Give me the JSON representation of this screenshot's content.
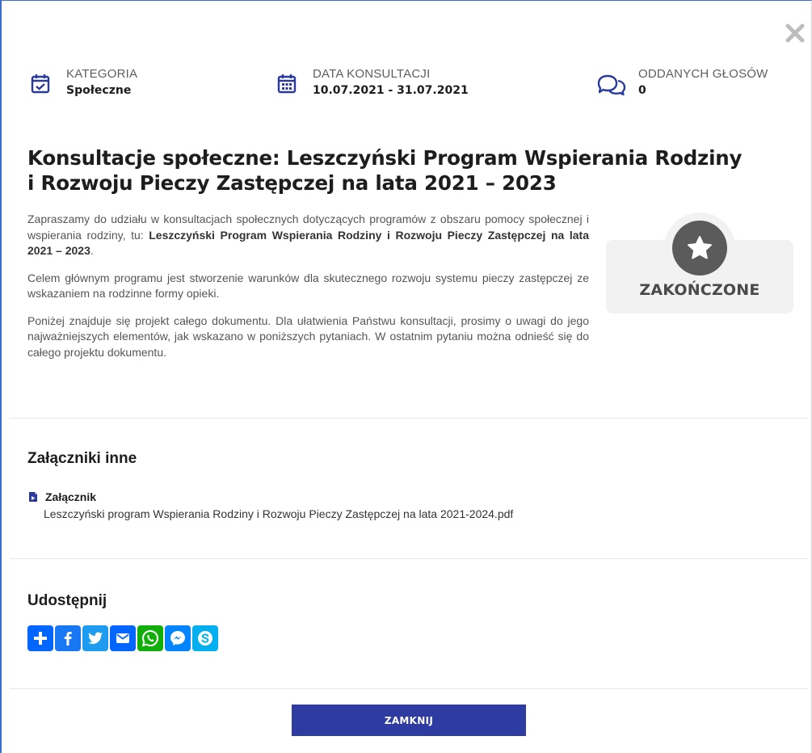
{
  "modal": {
    "close_icon": "close-icon",
    "meta": {
      "category": {
        "label": "KATEGORIA",
        "value": "Społeczne",
        "icon": "calendar-check-icon"
      },
      "date": {
        "label": "DATA KONSULTACJI",
        "value": "10.07.2021 - 31.07.2021",
        "icon": "calendar-icon"
      },
      "votes": {
        "label": "ODDANYCH GŁOSÓW",
        "value": "0",
        "icon": "chat-bubbles-icon"
      }
    },
    "title": "Konsultacje społeczne: Leszczyński Program Wspierania Rodziny i Rozwoju Pieczy Zastępczej na lata 2021 – 2023",
    "description": {
      "p1_pre": "Zapraszamy do udziału w konsultacjach społecznych dotyczących programów z obszaru pomocy społecznej i wspierania rodziny, tu: ",
      "p1_bold": "Leszczyński Program Wspierania Rodziny i Rozwoju Pieczy Zastępczej na lata 2021 – 2023",
      "p1_post": ".",
      "p2": "Celem głównym programu jest stworzenie warunków dla skutecznego rozwoju systemu pieczy zastępczej ze wskazaniem na rodzinne formy opieki.",
      "p3": "Poniżej znajduje się projekt całego dokumentu. Dla ułatwienia Państwu konsultacji, prosimy o uwagi do jego najważniejszych elementów, jak wskazano w poniższych pytaniach. W ostatnim pytaniu można odnieść się do całego projektu dokumentu."
    },
    "status": {
      "label": "ZAKOŃCZONE",
      "icon": "star-icon"
    },
    "attachments": {
      "title": "Załączniki inne",
      "label": "Załącznik",
      "file": "Leszczyński program Wspierania Rodziny i Rozwoju Pieczy Zastępczej na lata 2021-2024.pdf",
      "icon": "file-icon"
    },
    "share": {
      "title": "Udostępnij",
      "buttons": [
        {
          "name": "addtoany",
          "icon": "plus-icon",
          "color": "#0166ff"
        },
        {
          "name": "facebook",
          "icon": "facebook-icon",
          "color": "#1877f2"
        },
        {
          "name": "twitter",
          "icon": "twitter-icon",
          "color": "#1d9bf0"
        },
        {
          "name": "email",
          "icon": "email-icon",
          "color": "#0166ff"
        },
        {
          "name": "whatsapp",
          "icon": "whatsapp-icon",
          "color": "#12af0a"
        },
        {
          "name": "messenger",
          "icon": "messenger-icon",
          "color": "#0084ff"
        },
        {
          "name": "skype",
          "icon": "skype-icon",
          "color": "#00aff0"
        }
      ]
    },
    "close_button": "ZAMKNIJ"
  },
  "colors": {
    "accent": "#2e3ba0",
    "icon_blue": "#2a3a9c",
    "status_grey": "#5b5b5b"
  }
}
